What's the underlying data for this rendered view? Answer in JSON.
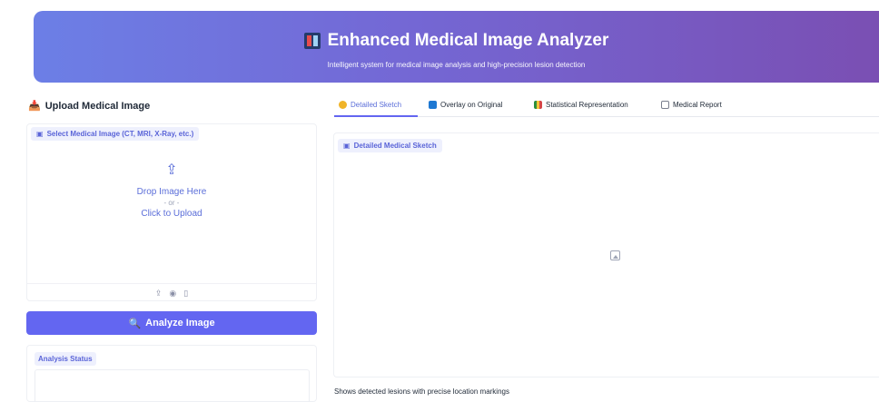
{
  "header": {
    "title": "Enhanced Medical Image Analyzer",
    "subtitle": "Intelligent system for medical image analysis and high-precision lesion detection",
    "icon": "medical-image-icon"
  },
  "upload": {
    "section_title": "Upload Medical Image",
    "select_label": "Select Medical Image (CT, MRI, X-Ray, etc.)",
    "drop_text": "Drop Image Here",
    "or_text": "- or -",
    "click_text": "Click to Upload"
  },
  "actions": {
    "analyze_label": "Analyze Image"
  },
  "status": {
    "label": "Analysis Status"
  },
  "tabs": [
    {
      "label": "Detailed Sketch",
      "icon": "palette-icon",
      "active": true
    },
    {
      "label": "Overlay on Original",
      "icon": "overlay-icon",
      "active": false
    },
    {
      "label": "Statistical Representation",
      "icon": "chart-icon",
      "active": false
    },
    {
      "label": "Medical Report",
      "icon": "report-icon",
      "active": false
    }
  ],
  "sketch": {
    "label": "Detailed Medical Sketch",
    "caption": "Shows detected lesions with precise location markings"
  },
  "colors": {
    "accent": "#6366f1",
    "banner_start": "#6c7fe6",
    "banner_end": "#7a4fb3"
  }
}
